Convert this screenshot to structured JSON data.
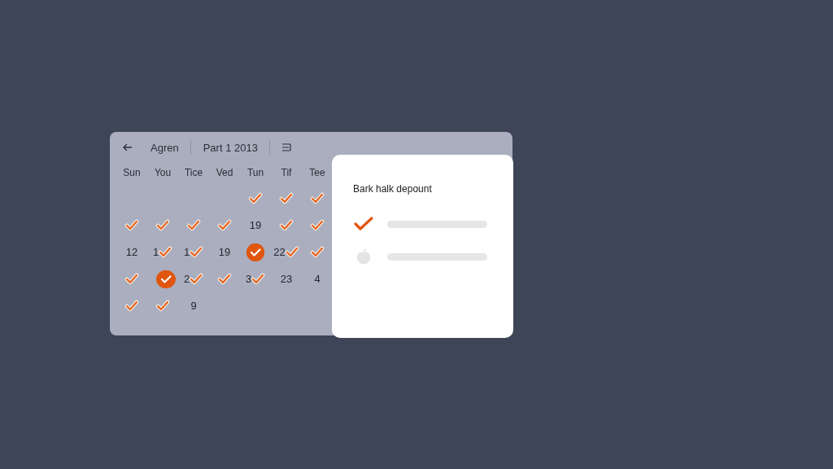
{
  "calendar": {
    "back_label": "Agren",
    "month": "Part 1 2013",
    "weekdays": [
      "Sun",
      "You",
      "Tice",
      "Ved",
      "Tun",
      "Tif",
      "Tee"
    ],
    "weeks": [
      [
        {
          "checked": true,
          "selected": false
        },
        {
          "checked": true,
          "selected": false
        },
        {
          "checked": true,
          "selected": false
        }
      ],
      [
        {
          "checked": true,
          "selected": false
        },
        {
          "checked": true,
          "selected": false
        },
        {
          "checked": true,
          "selected": false
        },
        {
          "checked": true,
          "selected": false
        },
        {
          "text": "19",
          "checked": false,
          "selected": false
        },
        {
          "checked": true,
          "selected": false
        },
        {
          "checked": true,
          "selected": false
        }
      ],
      [
        {
          "text": "12",
          "checked": false,
          "selected": false
        },
        {
          "text": "1",
          "checked": true,
          "selected": false
        },
        {
          "text": "1",
          "checked": true,
          "selected": false
        },
        {
          "text": "19",
          "checked": false,
          "selected": false
        },
        {
          "checked": true,
          "selected": true
        },
        {
          "text": "22",
          "checked": true,
          "selected": false
        },
        {
          "checked": true,
          "selected": false
        }
      ],
      [
        {
          "checked": true,
          "selected": false
        },
        {
          "checked": true,
          "selected": true
        },
        {
          "text": "2",
          "checked": true,
          "selected": false
        },
        {
          "checked": true,
          "selected": false
        },
        {
          "text": "3",
          "checked": true,
          "selected": false
        },
        {
          "text": "23",
          "checked": false,
          "selected": false
        },
        {
          "text": "4",
          "checked": false,
          "selected": false
        }
      ],
      [
        {
          "checked": true,
          "selected": false
        },
        {
          "checked": true,
          "selected": false
        },
        {
          "text": "9",
          "checked": false,
          "selected": false
        }
      ]
    ]
  },
  "popup": {
    "title": "Bark halk depount",
    "items": [
      {
        "checked": true
      },
      {
        "checked": false
      }
    ]
  }
}
